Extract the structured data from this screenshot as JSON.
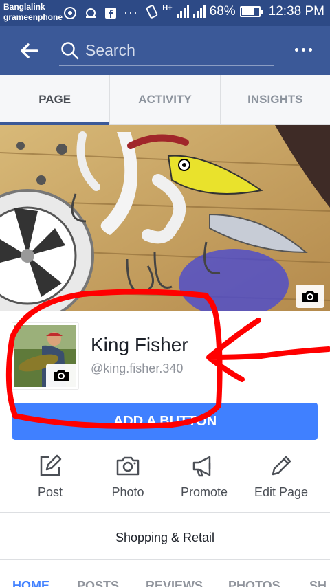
{
  "status_bar": {
    "carrier1": "Banglalink",
    "carrier2": "grameenphone",
    "battery_percent": "68%",
    "battery_level": 0.68,
    "time": "12:38 PM",
    "network": "H+"
  },
  "header": {
    "search_placeholder": "Search"
  },
  "tabs": [
    {
      "label": "PAGE",
      "active": true
    },
    {
      "label": "ACTIVITY",
      "active": false
    },
    {
      "label": "INSIGHTS",
      "active": false
    }
  ],
  "profile": {
    "name": "King Fisher",
    "handle": "@king.fisher.340"
  },
  "add_button_label": "ADD A BUTTON",
  "actions": [
    {
      "label": "Post",
      "icon": "edit-post-icon"
    },
    {
      "label": "Photo",
      "icon": "camera-icon"
    },
    {
      "label": "Promote",
      "icon": "megaphone-icon"
    },
    {
      "label": "Edit Page",
      "icon": "pencil-icon"
    }
  ],
  "category": "Shopping & Retail",
  "subtabs": [
    {
      "label": "HOME",
      "active": true
    },
    {
      "label": "POSTS",
      "active": false
    },
    {
      "label": "REVIEWS",
      "active": false
    },
    {
      "label": "PHOTOS",
      "active": false
    },
    {
      "label": "SH",
      "active": false
    }
  ],
  "colors": {
    "status_bar": "#2d4a86",
    "header": "#3b5998",
    "accent": "#4080ff",
    "annotation": "#ff0000"
  }
}
